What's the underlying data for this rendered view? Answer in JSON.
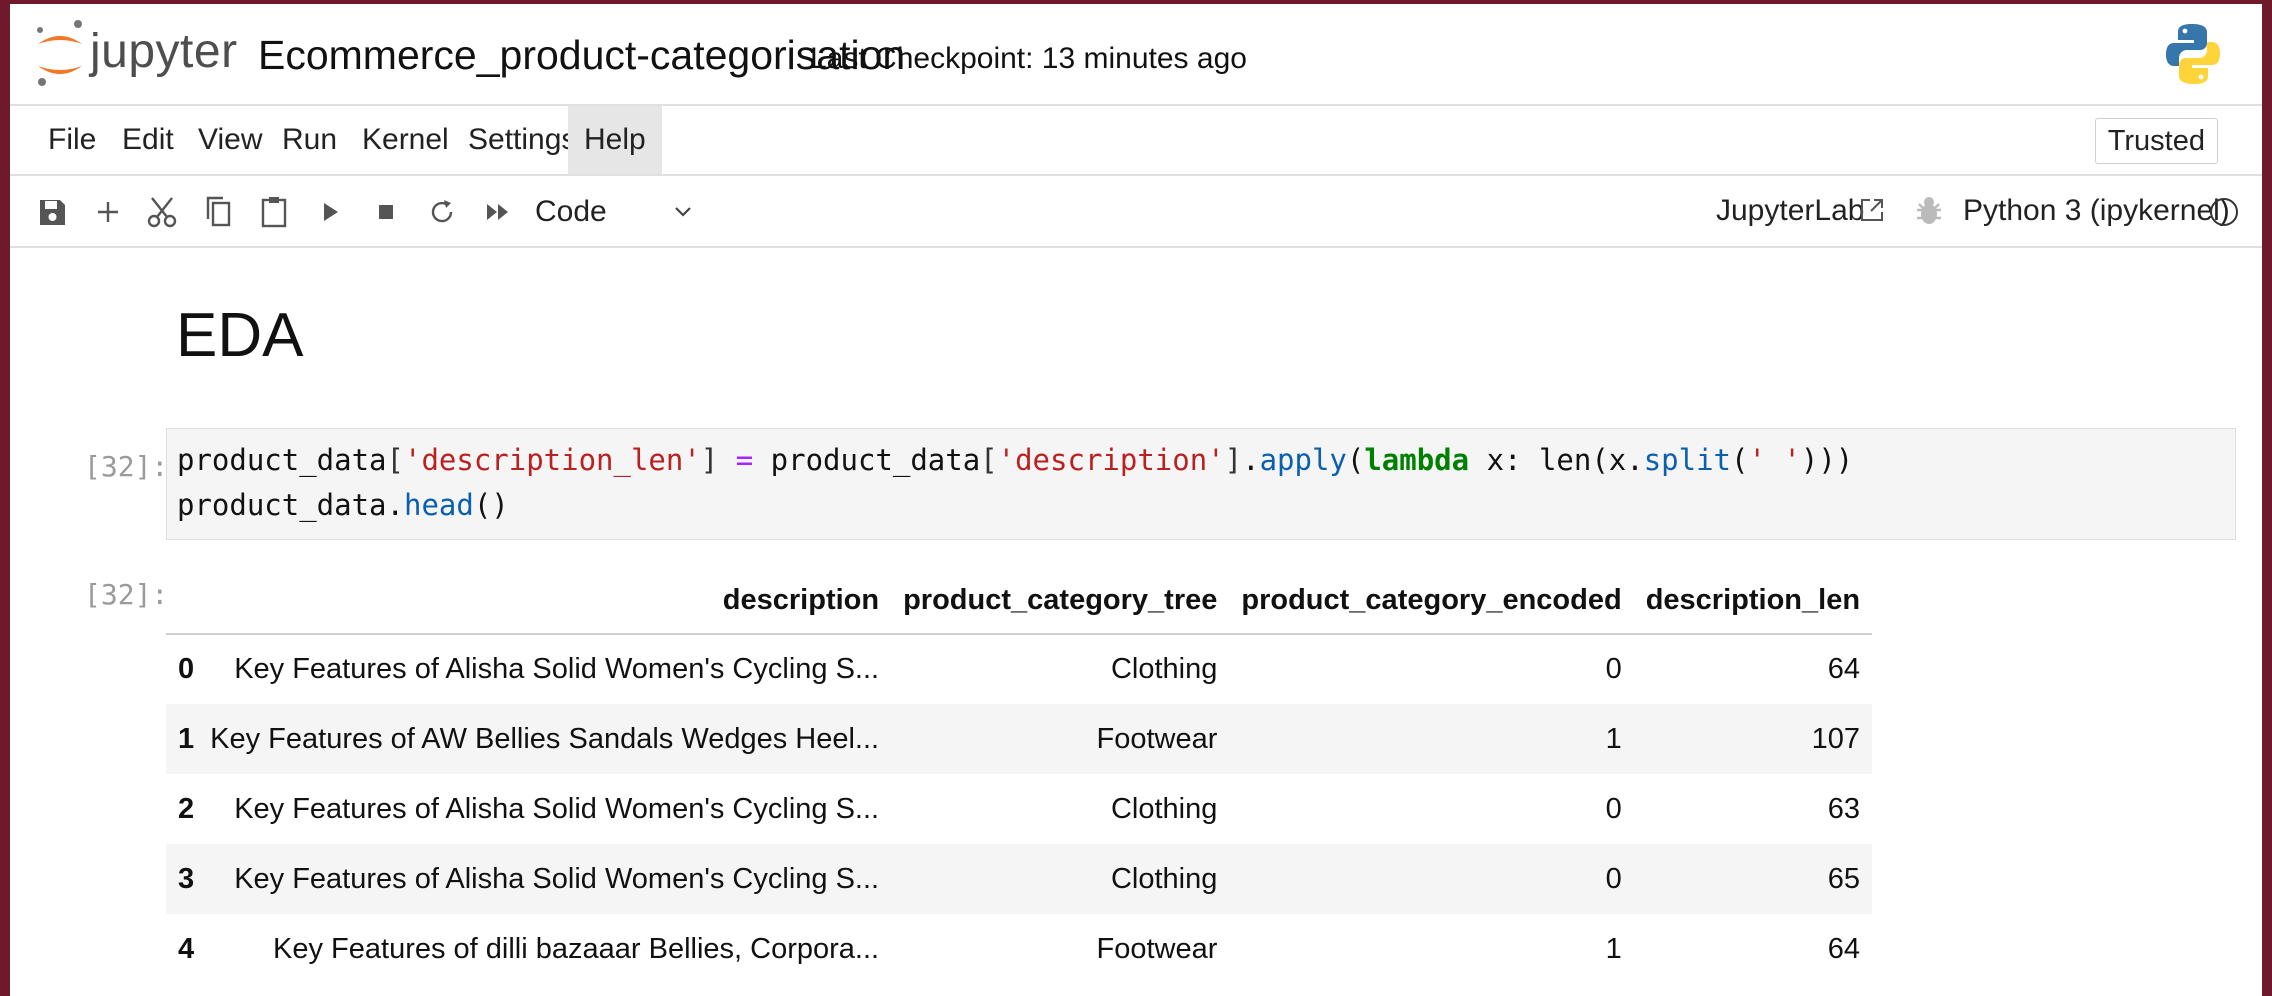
{
  "header": {
    "logo_text": "jupyter",
    "notebook_title": "Ecommerce_product-categorisation",
    "checkpoint": "Last Checkpoint: 13 minutes ago"
  },
  "menu": {
    "items": [
      "File",
      "Edit",
      "View",
      "Run",
      "Kernel",
      "Settings",
      "Help"
    ],
    "active": "Help",
    "trusted": "Trusted"
  },
  "toolbar": {
    "icons": [
      "save-icon",
      "add-icon",
      "cut-icon",
      "copy-icon",
      "paste-icon",
      "run-icon",
      "stop-icon",
      "restart-icon",
      "fast-forward-icon"
    ],
    "cell_type": "Code",
    "jupyterlab_link": "JupyterLab",
    "kernel": "Python 3 (ipykernel)"
  },
  "notebook": {
    "heading": "EDA",
    "input_prompt": "[32]:",
    "output_prompt": "[32]:",
    "code": {
      "l1_a": "product_data",
      "l1_b": "[",
      "l1_c": "'description_len'",
      "l1_d": "]",
      "l1_e": " = ",
      "l1_f": "product_data",
      "l1_g": "[",
      "l1_h": "'description'",
      "l1_i": "]",
      "l1_j": ".",
      "l1_k": "apply",
      "l1_l": "(",
      "l1_m": "lambda",
      "l1_n": " x: len(x.",
      "l1_o": "split",
      "l1_p": "(",
      "l1_q": "' '",
      "l1_r": ")))",
      "l2_a": "product_data.",
      "l2_b": "head",
      "l2_c": "()"
    },
    "table": {
      "columns": [
        "",
        "description",
        "product_category_tree",
        "product_category_encoded",
        "description_len"
      ],
      "rows": [
        {
          "idx": "0",
          "description": "Key Features of Alisha Solid Women's Cycling S...",
          "category": "Clothing",
          "encoded": "0",
          "len": "64"
        },
        {
          "idx": "1",
          "description": "Key Features of AW Bellies Sandals Wedges Heel...",
          "category": "Footwear",
          "encoded": "1",
          "len": "107"
        },
        {
          "idx": "2",
          "description": "Key Features of Alisha Solid Women's Cycling S...",
          "category": "Clothing",
          "encoded": "0",
          "len": "63"
        },
        {
          "idx": "3",
          "description": "Key Features of Alisha Solid Women's Cycling S...",
          "category": "Clothing",
          "encoded": "0",
          "len": "65"
        },
        {
          "idx": "4",
          "description": "Key Features of dilli bazaaar Bellies, Corpora...",
          "category": "Footwear",
          "encoded": "1",
          "len": "64"
        }
      ]
    }
  },
  "colors": {
    "outer_background": "#6e1a2a",
    "jupyter_orange": "#f37726",
    "string": "#ba2121",
    "keyword": "#008000",
    "function": "#0a5fae",
    "operator": "#aa22ff"
  }
}
